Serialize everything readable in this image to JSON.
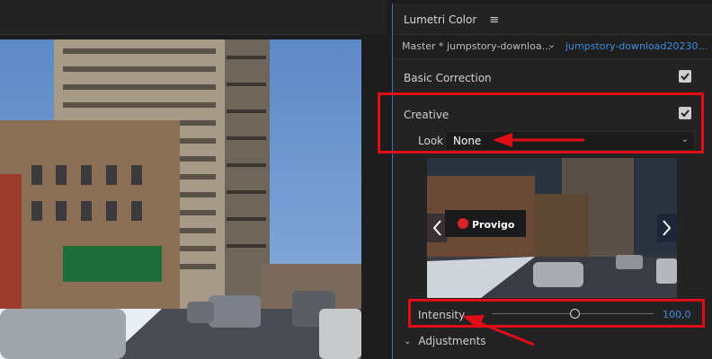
{
  "panel": {
    "title": "Lumetri Color",
    "menu_icon": "hamburger-menu-icon"
  },
  "clip_bar": {
    "master": "Master * jumpstory-downloa...",
    "clip": "jumpstory-download20230..."
  },
  "sections": {
    "basic_correction": {
      "label": "Basic Correction",
      "checked": true
    },
    "creative": {
      "label": "Creative",
      "checked": true
    }
  },
  "look": {
    "label": "Look",
    "value": "None"
  },
  "intensity": {
    "label": "Intensity",
    "value": "100,0",
    "level": 0.5
  },
  "adjustments": {
    "label": "Adjustments"
  },
  "preview": {
    "store_sign": "Provigo"
  },
  "colors": {
    "accent": "#3b8fe0",
    "highlight": "#e30d17",
    "panel_bg": "#232323"
  }
}
